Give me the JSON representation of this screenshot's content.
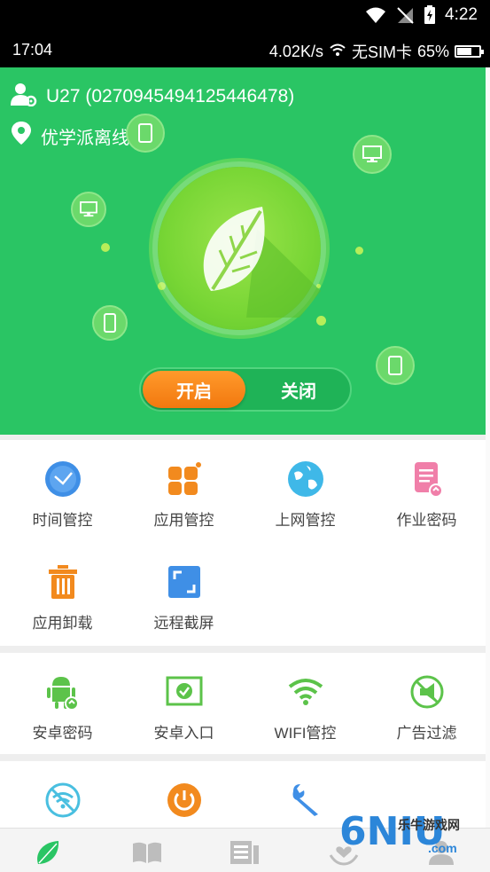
{
  "system_status": {
    "time": "4:22"
  },
  "device_status": {
    "time": "17:04",
    "speed": "4.02K/s",
    "sim": "无SIM卡",
    "battery_percent": "65%",
    "battery_level": 0.65
  },
  "hero": {
    "device_name": "U27 (0270945494125446478)",
    "location": "优学派离线",
    "toggle": {
      "on_label": "开启",
      "off_label": "关闭",
      "active": "开启"
    },
    "colors": {
      "background": "#2ac564",
      "accent": "#f2780f"
    }
  },
  "section1": {
    "items": [
      {
        "label": "时间管控",
        "icon": "clock-icon",
        "color": "#3f8fe6"
      },
      {
        "label": "应用管控",
        "icon": "apps-icon",
        "color": "#f28a1e"
      },
      {
        "label": "上网管控",
        "icon": "globe-icon",
        "color": "#3fb8e8"
      },
      {
        "label": "作业密码",
        "icon": "document-icon",
        "color": "#f07fa9"
      },
      {
        "label": "应用卸载",
        "icon": "trash-icon",
        "color": "#f28a1e"
      },
      {
        "label": "远程截屏",
        "icon": "screenshot-icon",
        "color": "#3f8fe6"
      }
    ]
  },
  "section2": {
    "items": [
      {
        "label": "安卓密码",
        "icon": "android-lock-icon",
        "color": "#5cc34a"
      },
      {
        "label": "安卓入口",
        "icon": "checkbox-screen-icon",
        "color": "#5cc34a"
      },
      {
        "label": "WIFI管控",
        "icon": "wifi-icon",
        "color": "#5cc34a"
      },
      {
        "label": "广告过滤",
        "icon": "ad-block-icon",
        "color": "#5cc34a"
      }
    ]
  },
  "section3": {
    "items": [
      {
        "icon": "no-wifi-icon",
        "color": "#49bfe0"
      },
      {
        "icon": "power-icon",
        "color": "#f28a1e"
      },
      {
        "icon": "wrench-icon",
        "color": "#3f8fe6"
      }
    ]
  },
  "bottom_nav": {
    "items": [
      {
        "icon": "leaf-icon",
        "active": true
      },
      {
        "icon": "book-icon",
        "active": false
      },
      {
        "icon": "news-icon",
        "active": false
      },
      {
        "icon": "heart-hands-icon",
        "active": false
      },
      {
        "icon": "profile-icon",
        "active": false
      }
    ]
  },
  "watermark": {
    "text": "乐牛游戏网",
    "logo": "6NIU",
    "domain": ".com"
  }
}
